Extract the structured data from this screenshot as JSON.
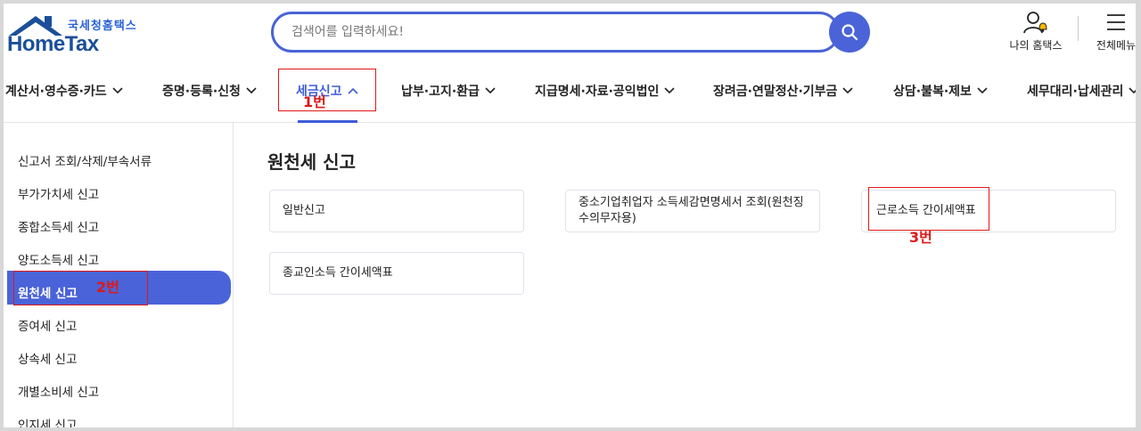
{
  "header": {
    "logo_ko": "국세청홈택스",
    "logo_en": "HomeTax",
    "search_placeholder": "검색어를 입력하세요!",
    "my_hometax": "나의 홈택스",
    "all_menu": "전체메뉴"
  },
  "nav": [
    {
      "label": "계산서·영수증·카드"
    },
    {
      "label": "증명·등록·신청"
    },
    {
      "label": "세금신고",
      "active": true
    },
    {
      "label": "납부·고지·환급"
    },
    {
      "label": "지급명세·자료·공익법인"
    },
    {
      "label": "장려금·연말정산·기부금"
    },
    {
      "label": "상담·불복·제보"
    },
    {
      "label": "세무대리·납세관리"
    }
  ],
  "sidebar": {
    "items": [
      {
        "label": "신고서 조회/삭제/부속서류"
      },
      {
        "label": "부가가치세 신고"
      },
      {
        "label": "종합소득세 신고"
      },
      {
        "label": "양도소득세 신고"
      },
      {
        "label": "원천세 신고",
        "active": true
      },
      {
        "label": "증여세 신고"
      },
      {
        "label": "상속세 신고"
      },
      {
        "label": "개별소비세 신고"
      },
      {
        "label": "인지세 신고"
      }
    ]
  },
  "main": {
    "title": "원천세 신고",
    "cards": [
      {
        "label": "일반신고"
      },
      {
        "label": "중소기업취업자 소득세감면명세서 조회(원천징수의무자용)"
      },
      {
        "label": "근로소득 간이세액표"
      },
      {
        "label": "종교인소득 간이세액표"
      }
    ]
  },
  "annotations": {
    "step1": "1번",
    "step2": "2번",
    "step3": "3번",
    "color": "#e01818"
  },
  "colors": {
    "accent": "#4a63d8",
    "logo_blue": "#1b4f9a"
  }
}
